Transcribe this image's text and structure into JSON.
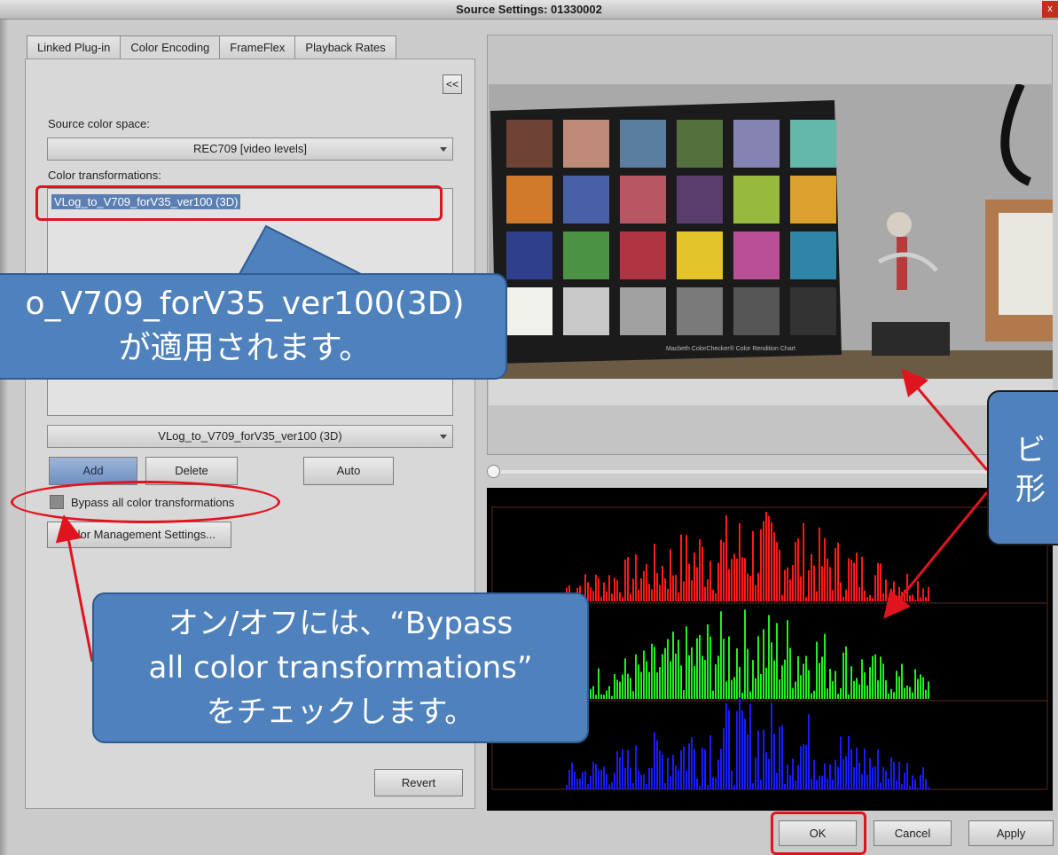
{
  "window": {
    "title": "Source Settings: 01330002",
    "close_label": "x"
  },
  "tabs": [
    {
      "label": "Linked Plug-in"
    },
    {
      "label": "Color Encoding"
    },
    {
      "label": "FrameFlex"
    },
    {
      "label": "Playback Rates"
    }
  ],
  "panel": {
    "collapse_label": "<<",
    "source_color_space_label": "Source color space:",
    "source_color_space_value": "REC709 [video levels]",
    "color_transformations_label": "Color transformations:",
    "transform_list_item": "VLog_to_V709_forV35_ver100 (3D)",
    "transform_select_value": "VLog_to_V709_forV35_ver100 (3D)",
    "add_label": "Add",
    "delete_label": "Delete",
    "auto_label": "Auto",
    "bypass_label": "Bypass all color transformations",
    "cms_label": "Color Management Settings...",
    "revert_label": "Revert"
  },
  "footer": {
    "ok_label": "OK",
    "cancel_label": "Cancel",
    "apply_label": "Apply"
  },
  "callouts": {
    "applied_line1": "o_V709_forV35_ver100(3D)",
    "applied_line2": "が適用されます。",
    "bypass_line1": "オン/オフには、“Bypass",
    "bypass_line2": "all color transformations”",
    "bypass_line3": "をチェックします。",
    "right_line1": "ビ",
    "right_line2": "形"
  },
  "video": {
    "chart_caption": "Macbeth ColorChecker® Color Rendition Chart",
    "patches": [
      "#6e4336",
      "#c08a78",
      "#5b7ea0",
      "#55703f",
      "#8583b3",
      "#63b8a9",
      "#d17a2c",
      "#4760a8",
      "#b85664",
      "#5a3d6d",
      "#97b93d",
      "#dca12d",
      "#2f3f8c",
      "#4b9244",
      "#ad3440",
      "#e3c52a",
      "#b84f97",
      "#2f85a8",
      "#f1f1ec",
      "#c8c8c8",
      "#a0a0a0",
      "#7a7a7a",
      "#555555",
      "#333333"
    ]
  },
  "colors": {
    "callout_fill": "#4f81bd",
    "highlight_red": "#e0141e"
  }
}
